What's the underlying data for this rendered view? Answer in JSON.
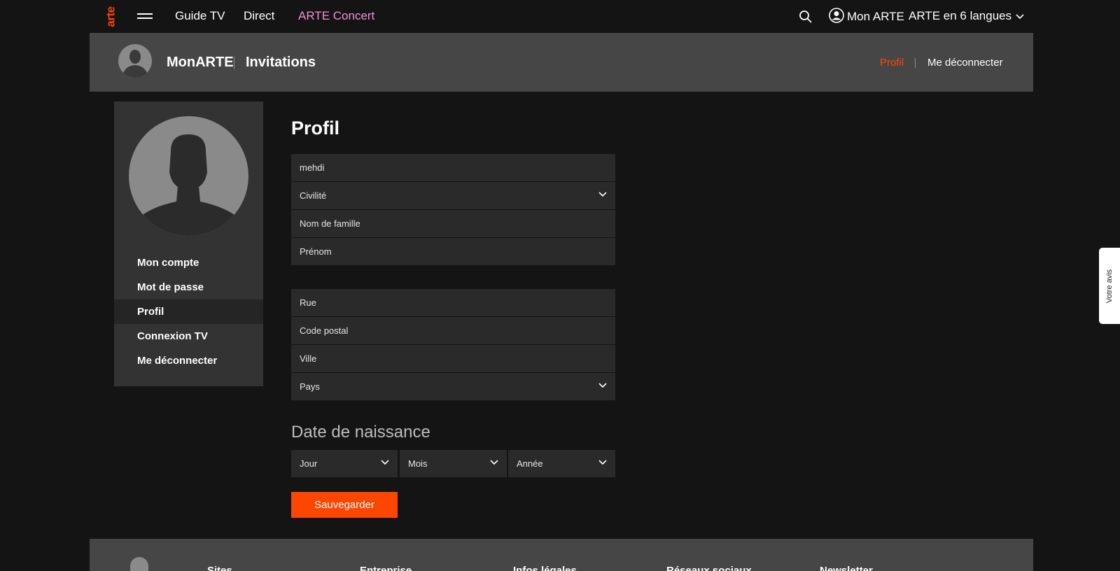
{
  "topnav": {
    "logo": "arte",
    "links": [
      "Guide TV",
      "Direct",
      "ARTE Concert"
    ],
    "account_label": "Mon ARTE",
    "languages_label": "ARTE en 6 langues",
    "icons": [
      "menu-icon",
      "search-icon",
      "user-circle-icon",
      "chevron-down-icon"
    ]
  },
  "header": {
    "title": "MonARTE",
    "invitations": "Invitations",
    "profile_link": "Profil",
    "logout_link": "Me déconnecter"
  },
  "sidebar": {
    "items": [
      {
        "label": "Mon compte",
        "active": false
      },
      {
        "label": "Mot de passe",
        "active": false
      },
      {
        "label": "Profil",
        "active": true
      },
      {
        "label": "Connexion TV",
        "active": false
      },
      {
        "label": "Me déconnecter",
        "active": false
      }
    ]
  },
  "form": {
    "title": "Profil",
    "username_value": "mehdi",
    "civility_placeholder": "Civilité",
    "lastname_placeholder": "Nom de famille",
    "firstname_placeholder": "Prénom",
    "street_placeholder": "Rue",
    "postal_placeholder": "Code postal",
    "city_placeholder": "Ville",
    "country_placeholder": "Pays",
    "dob_title": "Date de naissance",
    "day_placeholder": "Jour",
    "month_placeholder": "Mois",
    "year_placeholder": "Année",
    "save_label": "Sauvegarder"
  },
  "feedback_label": "Votre avis",
  "footer": {
    "columns": [
      "Sites",
      "Entreprise",
      "Infos légales",
      "Réseaux sociaux",
      "Newsletter"
    ]
  },
  "colors": {
    "accent": "#fd4600",
    "concert": "#f48fd0",
    "background": "#141414",
    "band": "#464646",
    "field": "#2a2a2a"
  }
}
